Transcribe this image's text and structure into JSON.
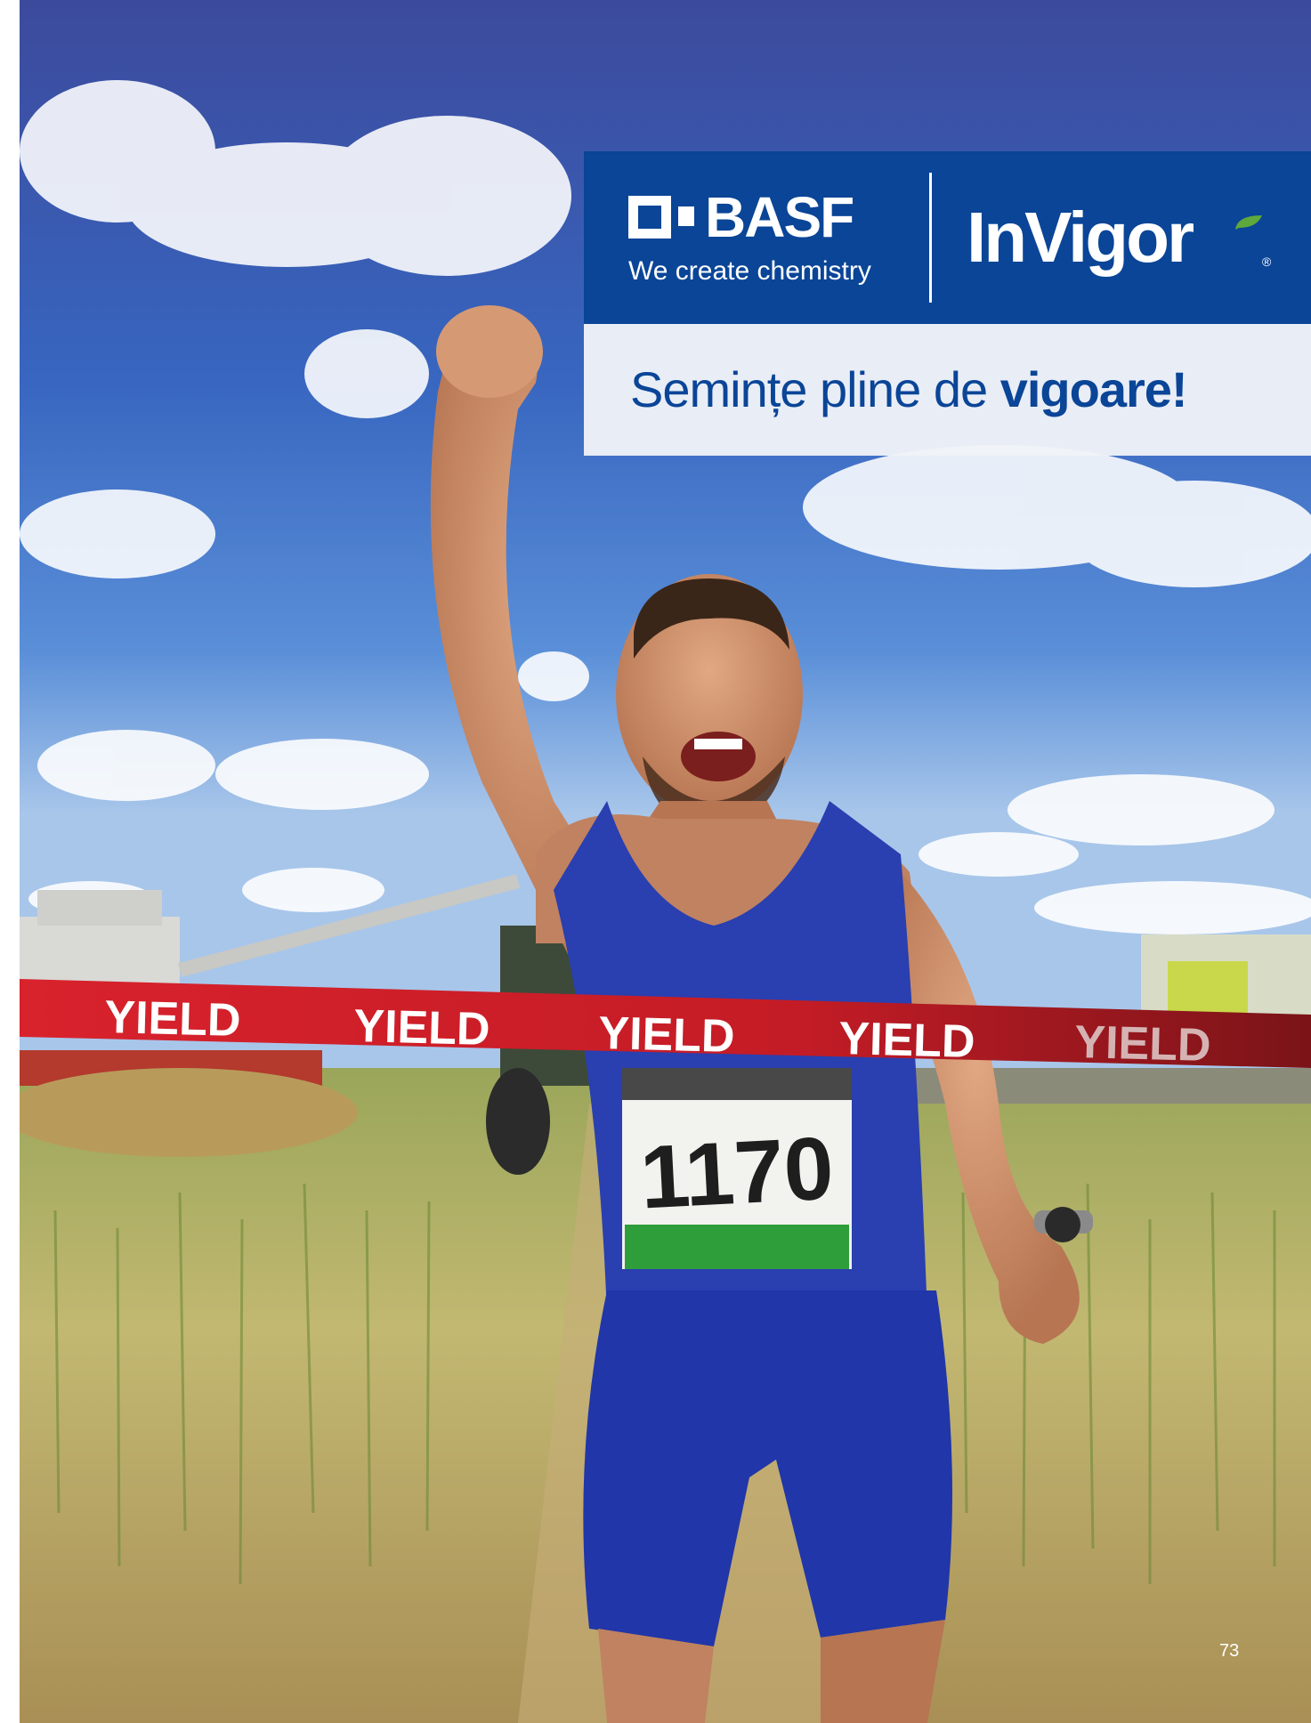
{
  "brand": {
    "company_name": "BASF",
    "tagline": "We create chemistry",
    "product_name": "InVigor",
    "registered_mark": "®"
  },
  "slogan": {
    "regular": "Semințe pline de ",
    "bold": "vigoare!"
  },
  "photo": {
    "ribbon_words": [
      "YIELD",
      "YIELD",
      "YIELD",
      "YIELD",
      "YIELD"
    ],
    "bib_number": "1170",
    "colors": {
      "sky": "#3a63b8",
      "ribbon": "#d0202a",
      "shirt": "#2a3fb0",
      "field": "#b9b26a",
      "bib_stripe": "#2e9e3a"
    }
  },
  "page_number": "73",
  "colors": {
    "brand_blue": "#0a4597",
    "brand_green": "#5fa83c"
  }
}
